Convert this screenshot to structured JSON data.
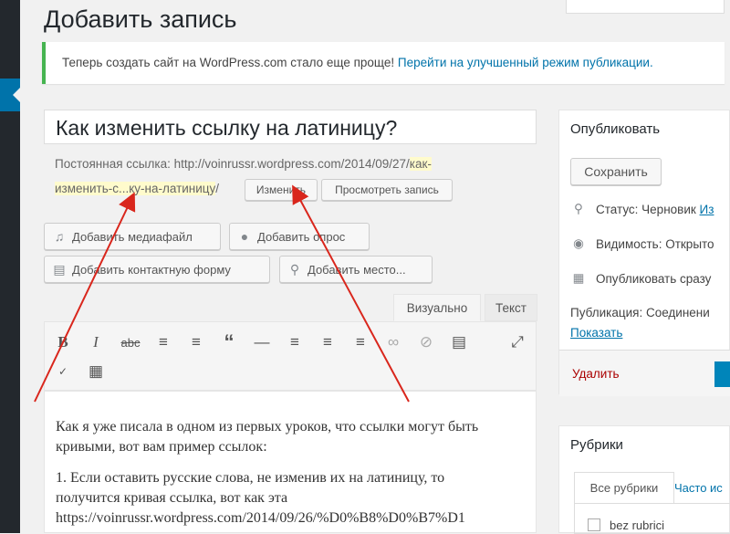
{
  "page": {
    "title": "Добавить запись"
  },
  "notice": {
    "text": "Теперь создать сайт на WordPress.com стало еще проще!",
    "link": "Перейти на улучшенный режим публикации."
  },
  "post": {
    "title": "Как изменить ссылку на латиницу?",
    "permalink_label": "Постоянная ссылка:",
    "permalink_base": "http://voinrussr.wordpress.com/2014/09/27/",
    "permalink_slug_1": "как-",
    "permalink_slug_2": "изменить-с...ку-на-латиницу",
    "permalink_end": "/",
    "edit_btn": "Изменить",
    "view_btn": "Просмотреть запись"
  },
  "media_buttons": {
    "add_media": "Добавить медиафайл",
    "add_poll": "Добавить опрос",
    "add_contact": "Добавить контактную форму",
    "add_location": "Добавить место..."
  },
  "editor": {
    "tab_visual": "Визуально",
    "tab_text": "Текст",
    "toolbar_icons": [
      "bold-icon",
      "italic-icon",
      "strikethrough-icon",
      "bullet-list-icon",
      "numbered-list-icon",
      "quote-icon",
      "horizontal-line-icon",
      "align-left-icon",
      "align-center-icon",
      "align-right-icon",
      "link-icon",
      "unlink-icon",
      "read-more-icon",
      "fullscreen-icon",
      "spellcheck-icon",
      "toolbar-toggle-icon"
    ],
    "paragraph_1_line1": "Как я уже писала в одном из первых уроков, что ссылки могут быть",
    "paragraph_1_line2": "кривыми, вот вам пример ссылок:",
    "paragraph_2_line1": "1. Если оставить русские слова, не изменив их на латиницу, то",
    "paragraph_2_line2": "получится кривая ссылка, вот как эта",
    "paragraph_2_line3": "https://voinrussr.wordpress.com/2014/09/26/%D0%B8%D0%B7%D1"
  },
  "publish": {
    "title": "Опубликовать",
    "save_btn": "Сохранить",
    "status_label": "Статус: Черновик",
    "status_link": "Из",
    "visibility": "Видимость: Открыто",
    "publish_now": "Опубликовать сразу",
    "publicize": "Публикация: Соединени",
    "show_link": "Показать",
    "delete": "Удалить"
  },
  "categories": {
    "title": "Рубрики",
    "tab_all": "Все рубрики",
    "tab_popular": "Часто ис",
    "item_1": "bez rubrici"
  },
  "colors": {
    "accent": "#0073aa",
    "annotation": "#d9261c",
    "notice_border": "#46b450"
  }
}
